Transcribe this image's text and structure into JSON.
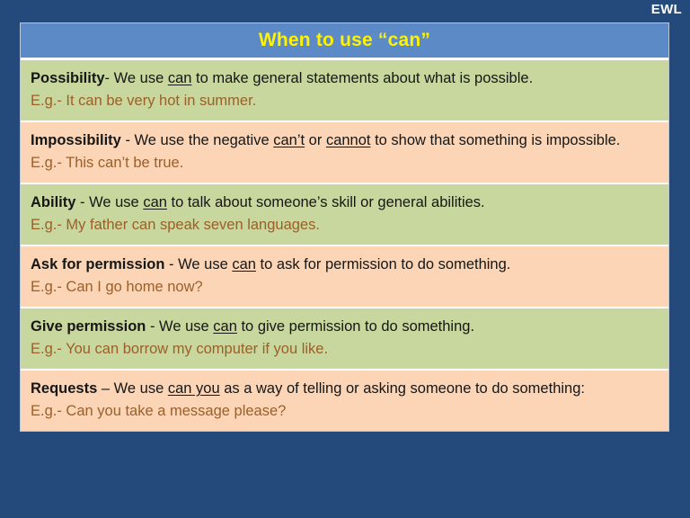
{
  "corner": {
    "label": "EWL"
  },
  "title": {
    "text": "When to use “can”"
  },
  "colors": {
    "background_blue": "#24497b",
    "title_blue": "#5b8ac6",
    "title_yellow": "#fff200",
    "row_green": "#c7d79e",
    "row_peach": "#fbd5b5",
    "example_brown": "#9c5f28",
    "body_black": "#161616"
  },
  "rows": [
    {
      "shade": "green",
      "heading": "Possibility",
      "body_before": "- We use ",
      "body_underline": "can",
      "body_after": " to make general statements about what is possible.",
      "example": "E.g.- It can be very hot in summer.",
      "justify": true
    },
    {
      "shade": "peach",
      "heading": "Impossibility",
      "body_before": " - We use the negative ",
      "body_underline": "can’t",
      "body_middle": " or ",
      "body_underline2": "cannot",
      "body_after": " to show that something is impossible.",
      "example": "E.g.- This can’t be true.",
      "justify": true
    },
    {
      "shade": "green",
      "heading": "Ability",
      "body_before": " - We use ",
      "body_underline": "can",
      "body_after": " to talk about someone’s skill or general abilities.",
      "example": "E.g.- My father can speak seven languages.",
      "justify": false
    },
    {
      "shade": "peach",
      "heading": "Ask for permission",
      "body_before": " - We use ",
      "body_underline": "can",
      "body_after": " to ask for permission to do something.",
      "example": "E.g.- Can I go home now?",
      "justify": false
    },
    {
      "shade": "green",
      "heading": "Give permission",
      "body_before": " - We use ",
      "body_underline": "can",
      "body_after": " to give permission to do something.",
      "example": "E.g.- You can borrow my computer if you like.",
      "justify": false
    },
    {
      "shade": "peach",
      "heading": "Requests",
      "body_before": " – We use ",
      "body_underline": "can you",
      "body_after": " as a way of telling or asking someone to do something:",
      "example": "E.g.- Can you take a message please?",
      "justify": true
    }
  ]
}
